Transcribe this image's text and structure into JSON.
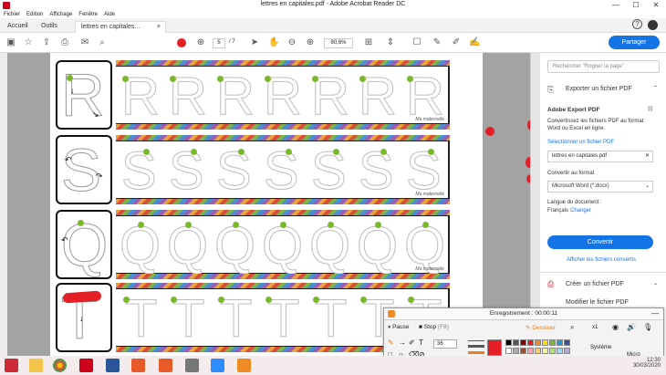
{
  "window": {
    "title": "lettres en capitales.pdf - Adobe Acrobat Reader DC",
    "minimize": "—",
    "maximize": "☐",
    "close": "✕"
  },
  "menu": [
    "Fichier",
    "Edition",
    "Affichage",
    "Fenêtre",
    "Aide"
  ],
  "tabs": {
    "home": "Accueil",
    "tools": "Outils",
    "doc": "lettres en capitales...",
    "doc_close": "×"
  },
  "toolbar": {
    "page_current": "5",
    "page_total": "/ 7",
    "zoom": "80,6%",
    "share_label": "Partager"
  },
  "document": {
    "rows": [
      {
        "letter": "R",
        "count": 7
      },
      {
        "letter": "S",
        "count": 7
      },
      {
        "letter": "Q",
        "count": 7
      },
      {
        "letter": "T",
        "count": 7
      }
    ],
    "signature": "Ma maternelle"
  },
  "right_panel": {
    "search_placeholder": "Rechercher \"Rogner la page\"",
    "export_header": "Exporter un fichier PDF",
    "export_title": "Adobe Export PDF",
    "export_desc_1": "Convertissez les fichiers PDF au format",
    "export_desc_2": "Word ou Excel en ligne.",
    "select_file": "Sélectionner un fichier PDF",
    "file_name": "lettres en capitales.pdf",
    "convert_to": "Convertir au format",
    "format": "Microsoft Word (*.docx)",
    "doc_lang_label": "Langue du document :",
    "doc_lang": "Français",
    "change": "Changer",
    "convert_btn": "Convertir",
    "show_converted": "Afficher les fichiers convertis",
    "create_pdf": "Créer un fichier PDF",
    "edit_pdf": "Modifier le fichier PDF"
  },
  "recorder": {
    "status": "Enregistrement : 00:00:11",
    "pause": "Pause",
    "stop": "Stop",
    "stop_key": "(F8)",
    "draw": "Dessiner",
    "zoom_level": "x1",
    "line_width": "36",
    "speaker": "Système",
    "mic": "Micro"
  },
  "taskbar": {
    "time": "12:30",
    "date": "30/03/2020"
  },
  "colors": {
    "accent": "#1473e6",
    "acrobat_red": "#d0021b",
    "guide_dot": "#7cb82f",
    "annotation_red": "#e41e26"
  }
}
